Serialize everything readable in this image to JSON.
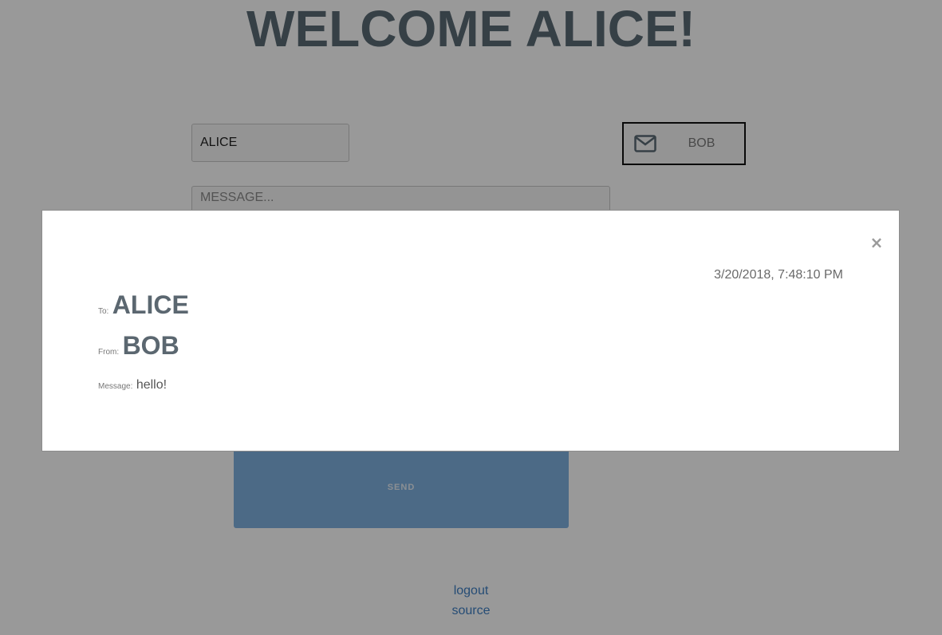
{
  "page": {
    "title": "WELCOME ALICE!"
  },
  "form": {
    "to_value": "ALICE",
    "message_placeholder": "MESSAGE...",
    "send_label": "SEND"
  },
  "inbox": {
    "icon": "mail-icon",
    "label": "BOB"
  },
  "footer": {
    "logout_label": "logout",
    "source_label": "source"
  },
  "modal": {
    "close_label": "×",
    "timestamp": "3/20/2018, 7:48:10 PM",
    "to_label": "To:",
    "to_value": "ALICE",
    "from_label": "From:",
    "from_value": "BOB",
    "message_label": "Message:",
    "message_value": "hello!"
  },
  "colors": {
    "title": "#5b6b76",
    "send_button": "#7fb1e0",
    "link": "#3f7fc4",
    "overlay": "rgba(0,0,0,0.4)"
  }
}
